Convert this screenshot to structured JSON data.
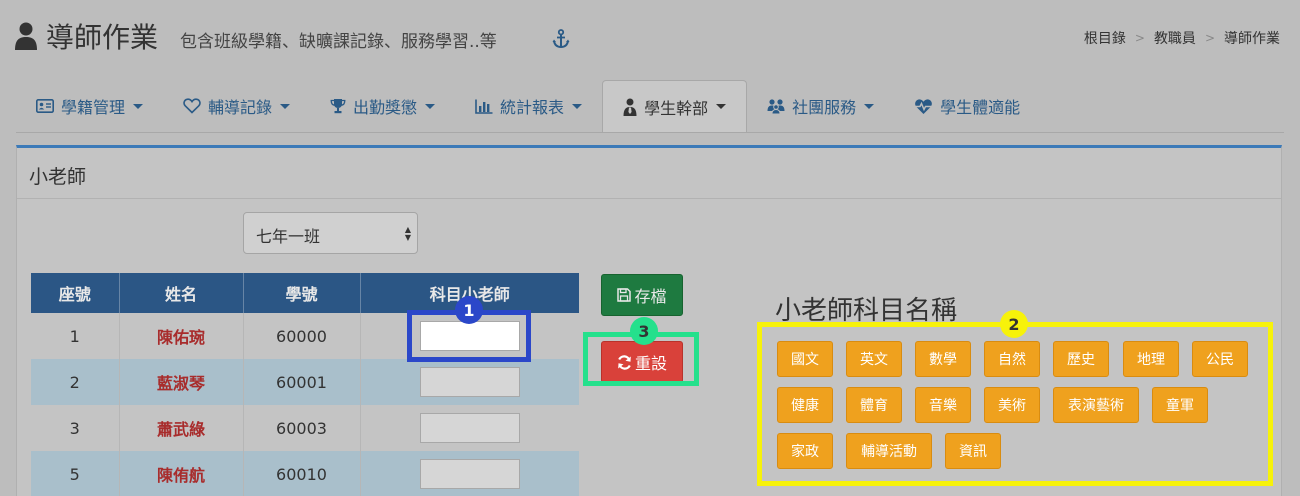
{
  "header": {
    "title": "導師作業",
    "subtitle": "包含班級學籍、缺曠課記錄、服務學習..等",
    "breadcrumb": [
      "根目錄",
      "教職員",
      "導師作業"
    ]
  },
  "tabs": [
    {
      "label": "學籍管理",
      "icon": "id-card-icon",
      "dropdown": true,
      "active": false
    },
    {
      "label": "輔導記錄",
      "icon": "heart-icon",
      "dropdown": true,
      "active": false
    },
    {
      "label": "出勤獎懲",
      "icon": "trophy-icon",
      "dropdown": true,
      "active": false
    },
    {
      "label": "統計報表",
      "icon": "bar-chart-icon",
      "dropdown": true,
      "active": false
    },
    {
      "label": "學生幹部",
      "icon": "user-tie-icon",
      "dropdown": true,
      "active": true
    },
    {
      "label": "社團服務",
      "icon": "group-icon",
      "dropdown": true,
      "active": false
    },
    {
      "label": "學生體適能",
      "icon": "heartbeat-icon",
      "dropdown": false,
      "active": false
    }
  ],
  "panel": {
    "title": "小老師",
    "class_select": {
      "selected": "七年一班"
    },
    "table": {
      "headers": [
        "座號",
        "姓名",
        "學號",
        "科目小老師"
      ],
      "rows": [
        {
          "seat": "1",
          "name": "陳佑琬",
          "student_id": "60000",
          "subject": ""
        },
        {
          "seat": "2",
          "name": "藍淑琴",
          "student_id": "60001",
          "subject": ""
        },
        {
          "seat": "3",
          "name": "蕭武綠",
          "student_id": "60003",
          "subject": ""
        },
        {
          "seat": "5",
          "name": "陳侑航",
          "student_id": "60010",
          "subject": ""
        }
      ]
    },
    "save_label": "存檔",
    "reset_label": "重設",
    "subjects_title": "小老師科目名稱",
    "subjects": [
      "國文",
      "英文",
      "數學",
      "自然",
      "歷史",
      "地理",
      "公民",
      "健康",
      "體育",
      "音樂",
      "美術",
      "表演藝術",
      "童軍",
      "家政",
      "輔導活動",
      "資訊"
    ]
  },
  "annotations": {
    "badge_1": "1",
    "badge_2": "2",
    "badge_3": "3"
  },
  "colors": {
    "header_blue": "#2b5685",
    "tab_text": "#2a5a86",
    "save_green": "#1e7a40",
    "reset_red": "#d9413a",
    "subject_orange": "#efa11e",
    "student_name_red": "#a82c2c",
    "annotation_blue": "#2b47c9",
    "annotation_green": "#25e08c",
    "annotation_yellow": "#f7f20a"
  }
}
